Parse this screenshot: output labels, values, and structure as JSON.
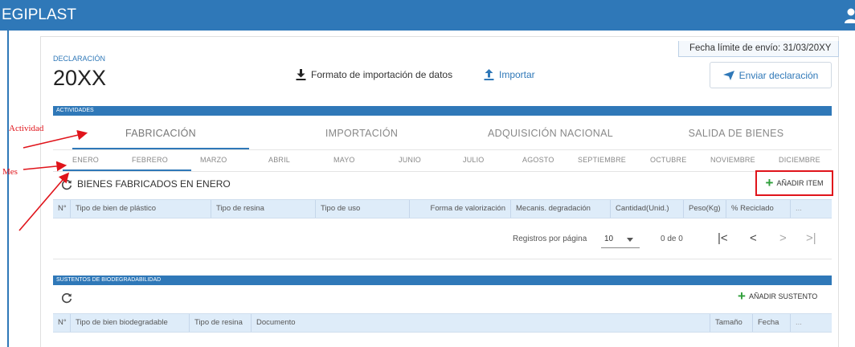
{
  "app": {
    "title": "EGIPLAST"
  },
  "header": {
    "deadline": "Fecha límite de envío: 31/03/20XY"
  },
  "declaration": {
    "label": "DECLARACIÓN",
    "year": "20XX",
    "format_link": "Formato de importación de datos",
    "import_link": "Importar",
    "send_button": "Enviar declaración"
  },
  "activities": {
    "section_label": "ACTIVIDADES",
    "tabs": [
      "FABRICACIÓN",
      "IMPORTACIÓN",
      "ADQUISICIÓN NACIONAL",
      "SALIDA DE BIENES"
    ],
    "selected_tab": "FABRICACIÓN",
    "months": [
      "ENERO",
      "FEBRERO",
      "MARZO",
      "ABRIL",
      "MAYO",
      "JUNIO",
      "JULIO",
      "AGOSTO",
      "SEPTIEMBRE",
      "OCTUBRE",
      "NOVIEMBRE",
      "DICIEMBRE"
    ],
    "selected_month": "ENERO",
    "list_title": "BIENES FABRICADOS EN ENERO",
    "add_button": "AÑADIR ITEM",
    "columns": [
      "N°",
      "Tipo de bien de plástico",
      "Tipo de resina",
      "Tipo de uso",
      "Forma de valorización",
      "Mecanis. degradación",
      "Cantidad(Unid.)",
      "Peso(Kg)",
      "% Reciclado",
      "..."
    ],
    "pager": {
      "rows_label": "Registros por página",
      "rows_value": "10",
      "range": "0 de 0",
      "first": "|<",
      "prev": "<",
      "next": ">",
      "last": ">|"
    }
  },
  "biodegradability": {
    "section_label": "SUSTENTOS DE BIODEGRADABILIDAD",
    "add_button": "AÑADIR SUSTENTO",
    "columns": [
      "N°",
      "Tipo de bien biodegradable",
      "Tipo de resina",
      "Documento",
      "Tamaño",
      "Fecha",
      "..."
    ]
  },
  "annotations": {
    "activity": "Actividad",
    "month": "Mes"
  },
  "colors": {
    "primary": "#2f78b8",
    "header_bg": "#deecf9",
    "accent_green": "#2e9e3a",
    "annotation_red": "#e0141b"
  },
  "icons": {
    "user": "user-icon",
    "download": "download-icon",
    "upload": "upload-icon",
    "send": "send-icon",
    "refresh": "refresh-icon",
    "plus": "plus-icon"
  }
}
